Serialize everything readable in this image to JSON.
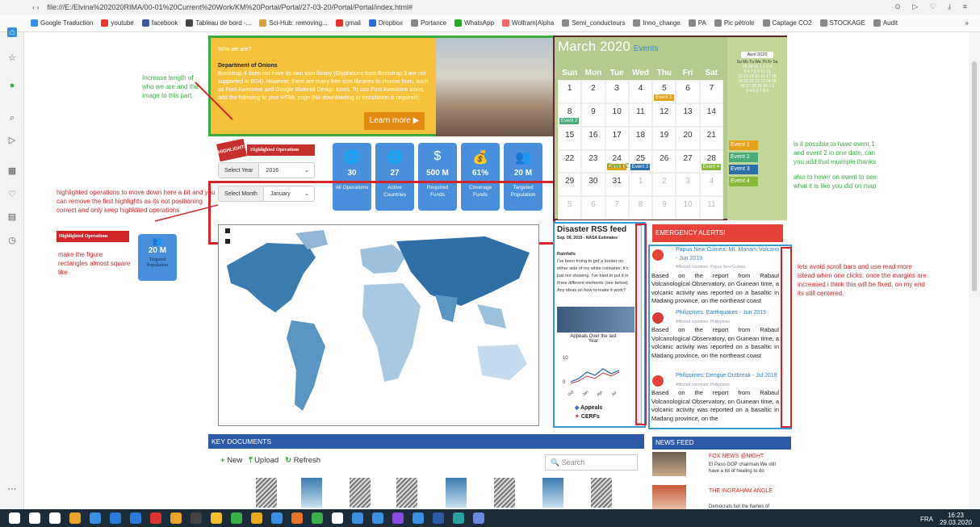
{
  "browser": {
    "url": "file:///E:/Elvina%202020RIMA/00-01%20Current%20Work/KM%20Portal/Portal/27-03-20/Portal/Portal/index.html#",
    "bookmarks": [
      "Google Traduction",
      "youtube",
      "facebook",
      "Tableau de bord -...",
      "Sci-Hub: removing...",
      "gmail",
      "Dropbox",
      "Portance",
      "WhatsApp",
      "Wolfram|Alpha",
      "Semi_conducteurs",
      "Inno_change",
      "PA",
      "Pic pétrole",
      "Captage CO2",
      "STOCKAGE",
      "Audit"
    ],
    "more": "»"
  },
  "hero": {
    "who": "Who we are?",
    "dept_label": "Department of Onions",
    "body": "Bootstrap 4 does not have its own icon library (Glyphicons from Bootstrap 3 are not supported in BS4). However, there are many free icon libraries to choose from, such as Font Awesome and Google Material Design Icons. To use Font Awesome icons, add the following to your HTML page (No downloading or installation is required):",
    "button": "Learn more ▶"
  },
  "ops": {
    "stamp": "HIGHLIGHTS",
    "title": "Highlighted Operations",
    "year_label": "Select Year",
    "year_value": "2016",
    "month_label": "Select Month",
    "month_value": "January",
    "figures": [
      {
        "icon": "🌐",
        "value": "30",
        "label": "All Operations"
      },
      {
        "icon": "🌐",
        "value": "27",
        "label": "Active Countries"
      },
      {
        "icon": "$",
        "value": "500 M",
        "label": "Required Funds"
      },
      {
        "icon": "💰",
        "value": "61%",
        "label": "Coverage Funds"
      },
      {
        "icon": "👥",
        "value": "20 M",
        "label": "Targeted Population"
      }
    ]
  },
  "calendar": {
    "month": "March 2020",
    "events_label": "Events",
    "days": [
      "Sun",
      "Mon",
      "Tue",
      "Wed",
      "Thu",
      "Fri",
      "Sat"
    ],
    "cells": [
      "1",
      "2",
      "3",
      "4",
      "5",
      "6",
      "7",
      "8",
      "9",
      "10",
      "11",
      "12",
      "13",
      "14",
      "15",
      "16",
      "17",
      "18",
      "19",
      "20",
      "21",
      "22",
      "23",
      "24",
      "25",
      "26",
      "27",
      "28",
      "29",
      "30",
      "31",
      "1",
      "2",
      "3",
      "4",
      "5",
      "6",
      "7",
      "8",
      "9",
      "10",
      "11"
    ],
    "cell_events": [
      {
        "idx": 4,
        "label": "Event 1",
        "color": "#e3a21a"
      },
      {
        "idx": 7,
        "label": "Event 2",
        "color": "#4aab78"
      },
      {
        "idx": 23,
        "label": "Event 1",
        "color": "#e3a21a"
      },
      {
        "idx": 24,
        "label": "Event 3",
        "color": "#2e6ea6"
      },
      {
        "idx": 27,
        "label": "Event 4",
        "color": "#8ab83a"
      }
    ],
    "event2_overlay": "Event 2",
    "mini_title": "April 2020",
    "mini_days": "Su Mo Tu We Th Fr Sa",
    "mini_rows": [
      "29 30 31 1 2 3 4",
      "5 6 7 8 9 10 11",
      "12 13 14 15 16 17 18",
      "19 20 21 22 23 24 25",
      "26 27 28 29 30 1 2",
      "3 4 5 6 7 8 9"
    ],
    "side_events": [
      {
        "label": "Event 1",
        "color": "#e3a21a"
      },
      {
        "label": "Event 2",
        "color": "#4aab78"
      },
      {
        "label": "Event 3",
        "color": "#2e6ea6"
      },
      {
        "label": "Event 4",
        "color": "#8ab83a"
      }
    ]
  },
  "rss": {
    "title": "Disaster RSS feed",
    "date": "Sep. 09, 2019 - NASA Estimates",
    "heading": "Rainfalls",
    "body": "I've been trying to get a border on either side of my white container. It's just not showing. I've tried to put it in three different elements (see below). Any ideas on how to make it work?",
    "chart_title": "Appeals Over the last Year",
    "legend_appeals": "Appeals",
    "legend_cerfs": "CERFs",
    "axis_labels": [
      "10",
      "0"
    ],
    "months": [
      "Oct",
      "Jan",
      "Apr",
      "Jul"
    ]
  },
  "emergency": {
    "title": "EMERGENCY ALERTS!",
    "items": [
      {
        "title": "Papua New Guinea: Mt. Manam Volcano - Jun 2019",
        "countries": "Affected countries: Papua New Guinea",
        "body": "Based on the report from Rabaul Volcanological Observatory, on Guinean time, a volcanic activity was reported on a basaltic in Madang province, on the northeast coast"
      },
      {
        "title": "Philippines: Earthquakes - Jun 2019",
        "countries": "Affected countries: Philippines",
        "body": "Based on the report from Rabaul Volcanological Observatory, on Guinean time, a volcanic activity was reported on a basaltic in Madang province, on the northeast coast"
      },
      {
        "title": "Philippines: Dengue Outbreak - Jul 2019",
        "countries": "Affected countries: Philippines",
        "body": "Based on the report from Rabaul Volcanological Observatory, on Guinean time, a volcanic activity was reported on a basaltic in Madang province, on the"
      }
    ]
  },
  "keydocs": {
    "title": "KEY DOCUMENTS",
    "new": "New",
    "upload": "Upload",
    "refresh": "Refresh",
    "search": "Search"
  },
  "news": {
    "title": "NEWS FEED",
    "items": [
      {
        "title": "FOX NEWS @NIGHT",
        "body": "El Paso GOP chairman We still have a lot of healing to do"
      },
      {
        "title": "THE INGRAHAM ANGLE",
        "body": "Democrats fan the flames of"
      }
    ]
  },
  "annotations": {
    "a1": "Increase length of who we are and the image to this part",
    "a2": "highlighted operations to move down here a bit and you can remove the first highlights as its not positioning correct and only keep highklited operations",
    "a3": "make the figure rectangles almost square like",
    "a4": "is it possible to have event 1 and event 2 in one date, can you add that example thanks",
    "a5": "also to hover on event to see what it is like you did on map",
    "a6": "lets avoid scroll bars and use read more istead when one clicks. once the margins are increased i think this will be fixed, on my end its still centered.",
    "mini_op": "Highlighted Operations",
    "mini_fig_value": "20 M",
    "mini_fig_label": "Targeted Population"
  },
  "taskbar": {
    "lang": "FRA",
    "time": "16:23",
    "date": "29.03.2020"
  }
}
